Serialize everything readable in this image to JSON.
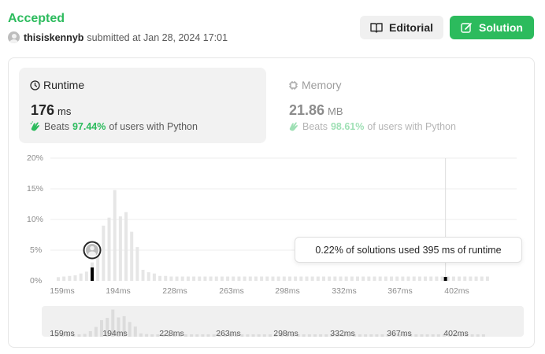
{
  "header": {
    "status": "Accepted",
    "username": "thisiskennyb",
    "submitted_text": "submitted at Jan 28, 2024 17:01"
  },
  "buttons": {
    "editorial_label": "Editorial",
    "solution_label": "Solution"
  },
  "runtime": {
    "label": "Runtime",
    "value": "176",
    "unit": "ms",
    "beats_prefix": "Beats",
    "beats_pct": "97.44%",
    "beats_suffix": "of users with Python"
  },
  "memory": {
    "label": "Memory",
    "value": "21.86",
    "unit": "MB",
    "beats_prefix": "Beats",
    "beats_pct": "98.61%",
    "beats_suffix": "of users with Python"
  },
  "tooltip": {
    "text": "0.22% of solutions used 395 ms of runtime"
  },
  "colors": {
    "accent": "#2cbb5d",
    "bar": "#e6e6e6",
    "selected_bar": "#000000"
  },
  "chart_data": {
    "type": "bar",
    "ylabels": [
      "20%",
      "15%",
      "10%",
      "5%",
      "0%"
    ],
    "ylim": [
      0,
      20
    ],
    "xticks": [
      "159ms",
      "194ms",
      "228ms",
      "263ms",
      "298ms",
      "332ms",
      "367ms",
      "402ms"
    ],
    "x_start_ms": 155,
    "bin_ms": 3.5,
    "values": [
      0.6,
      0.7,
      0.8,
      0.9,
      1.2,
      1.5,
      3.0,
      5.3,
      9.0,
      10.3,
      14.8,
      10.5,
      11.2,
      8.0,
      5.5,
      1.8,
      1.4,
      1.2,
      0.8,
      0.8,
      0.7,
      0.7,
      0.7,
      0.7,
      0.7,
      0.7,
      0.7,
      0.7,
      0.7,
      0.7,
      0.7,
      0.7,
      0.7,
      0.7,
      0.7,
      0.7,
      0.7,
      0.7,
      0.7,
      0.7,
      0.7,
      0.7,
      0.7,
      0.7,
      0.7,
      0.7,
      0.7,
      0.7,
      0.7,
      0.7,
      0.7,
      0.7,
      0.7,
      0.7,
      0.7,
      0.7,
      0.7,
      0.7,
      0.7,
      0.7,
      0.7,
      0.7,
      0.7,
      0.7,
      0.7,
      0.7,
      0.7,
      0.7,
      0.7,
      0.7,
      0.7,
      0.7,
      0.7,
      0.7,
      0.7,
      0.7,
      0.7
    ],
    "your_runtime_ms": 176,
    "hover_runtime_ms": 395,
    "hover_pct": 0.22
  }
}
